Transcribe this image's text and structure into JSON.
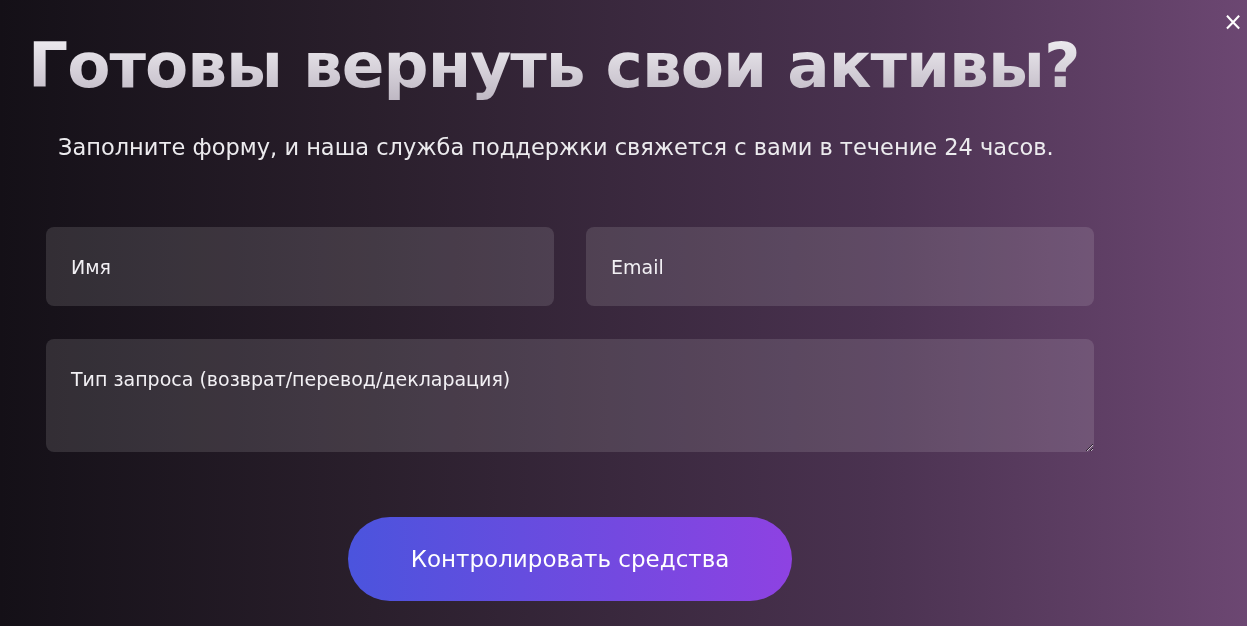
{
  "modal": {
    "close": "×",
    "title": "Готовы вернуть свои активы?",
    "subtitle": "Заполните форму, и наша служба поддержки свяжется с вами в течение 24 часов.",
    "fields": [
      {
        "placeholder": "Имя"
      },
      {
        "placeholder": "Email"
      }
    ],
    "request_type": {
      "placeholder": "Тип запроса (возврат/перевод/декларация)"
    },
    "submit": "Контролировать средства"
  }
}
